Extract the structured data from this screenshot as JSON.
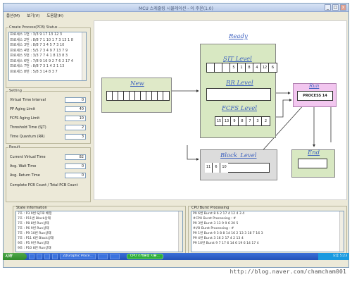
{
  "window": {
    "title": "MCU 스케줄링 시뮬레이션 - 이 주윤(1.0)",
    "btn_min": "_",
    "btn_max": "□",
    "btn_close": "x"
  },
  "menu": [
    "옵션(M)",
    "보기(V)",
    "도움말(H)"
  ],
  "left": {
    "create_title": "Create Process(PCB) Status",
    "pcb_rows": [
      "프로세스 1번 : 3/3 9 17 13 12 3",
      "프로세스 2번 : 8/8 7 1 10 1 7 3 13 1 8",
      "프로세스 3번 : 8/8 7 3 4 5 7 3 10",
      "프로세스 4번 : 5/5 7 3 4 9 7 13 7 9",
      "프로세스 5번 : 3/3 7 7 4 1 8 13 8 3",
      "프로세스 6번 : 7/8 9 16 9 2 7 6 2 17 4",
      "프로세스 7번 : 8/8 7 3 1 4 2 1 13",
      "프로세스 8번 : 5/8 3 14 8 3 7"
    ],
    "setting_title": "Setting",
    "settings": [
      {
        "label": "Virtual Time Interval",
        "value": "0"
      },
      {
        "label": "PP Aging Limit",
        "value": "40"
      },
      {
        "label": "FCFS Aging Limit",
        "value": "10"
      },
      {
        "label": "Threshold Time (SJT)",
        "value": "2"
      },
      {
        "label": "Time Quantum (RR)",
        "value": "3"
      }
    ],
    "result_title": "Result",
    "results": [
      {
        "label": "Current Virtual Time",
        "value": "82"
      },
      {
        "label": "Avg. Wait Time",
        "value": "0"
      },
      {
        "label": "Avg. Return Time",
        "value": "0"
      }
    ],
    "complete_label": "Complete PCB Count / Total PCB Count"
  },
  "diagram": {
    "ready": "Ready",
    "new": "New",
    "sjt": "SJT Level",
    "rr": "RR Level",
    "fcfs": "FCFS Level",
    "run": "Run",
    "end": "End",
    "block": "Block_Level",
    "sjt_queue": [
      "",
      "",
      "",
      "5",
      "1",
      "8",
      "4",
      "12",
      "6",
      "17"
    ],
    "fcfs_queue": [
      "15",
      "13",
      "9",
      "8",
      "7",
      "3",
      "2"
    ],
    "block_queue": [
      "11",
      "6",
      "10"
    ],
    "new_queue": [
      "",
      "",
      "",
      "",
      "",
      "",
      "",
      "",
      "",
      "",
      ""
    ],
    "running_process": "PROCESS 14"
  },
  "state_info": {
    "title": "State Information",
    "rows": [
      "7초 : P3 9번 SJT로 배정",
      "7초 : P11번 Block상태",
      "7초 : P8 8번 Run상태",
      "7초 : P6 9번 Run상태",
      "7초 : P9 10번 Run상태",
      "7초 : P11 6번 Block상태",
      "9초 : P5 9번 Run상태",
      "9초 : P10 8번 Run상태"
    ]
  },
  "cpu_burst": {
    "title": "CPU Burst Processing",
    "rows": [
      "P9 6번 Burst 8 6 2 17 4 12 4 3 4",
      "#CPU Burst Processing : #",
      "P9 3번 Burst 3 13 9 9 6 20 5",
      "#I/O Burst Processing : #",
      "P9 1번 Burst 9 3 8 8 14 16 2 13 3 18 7 16 3",
      "P9 4번 Burst 3 16 2 17 4 2 13 4",
      "P9 10번 Burst 9 7 17 6 14 6 19 6 14 17 4"
    ]
  },
  "taskbar": {
    "start": "시작",
    "items": [
      "",
      "",
      "",
      "",
      "2DGraphic Proce...",
      "",
      ""
    ],
    "active_app": "CPU 스케줄링 시뮬...",
    "tray": "오후 5:23"
  },
  "watermark": "http://blog.naver.com/chamcham001",
  "colors": {
    "ready_bg": "#d8e8c2",
    "new_bg": "#dfe9c8",
    "run_bg": "#f2c6ef",
    "end_bg": "#d8e8c2",
    "block_bg": "#dcdcdc",
    "heading": "#3a5fbf"
  }
}
